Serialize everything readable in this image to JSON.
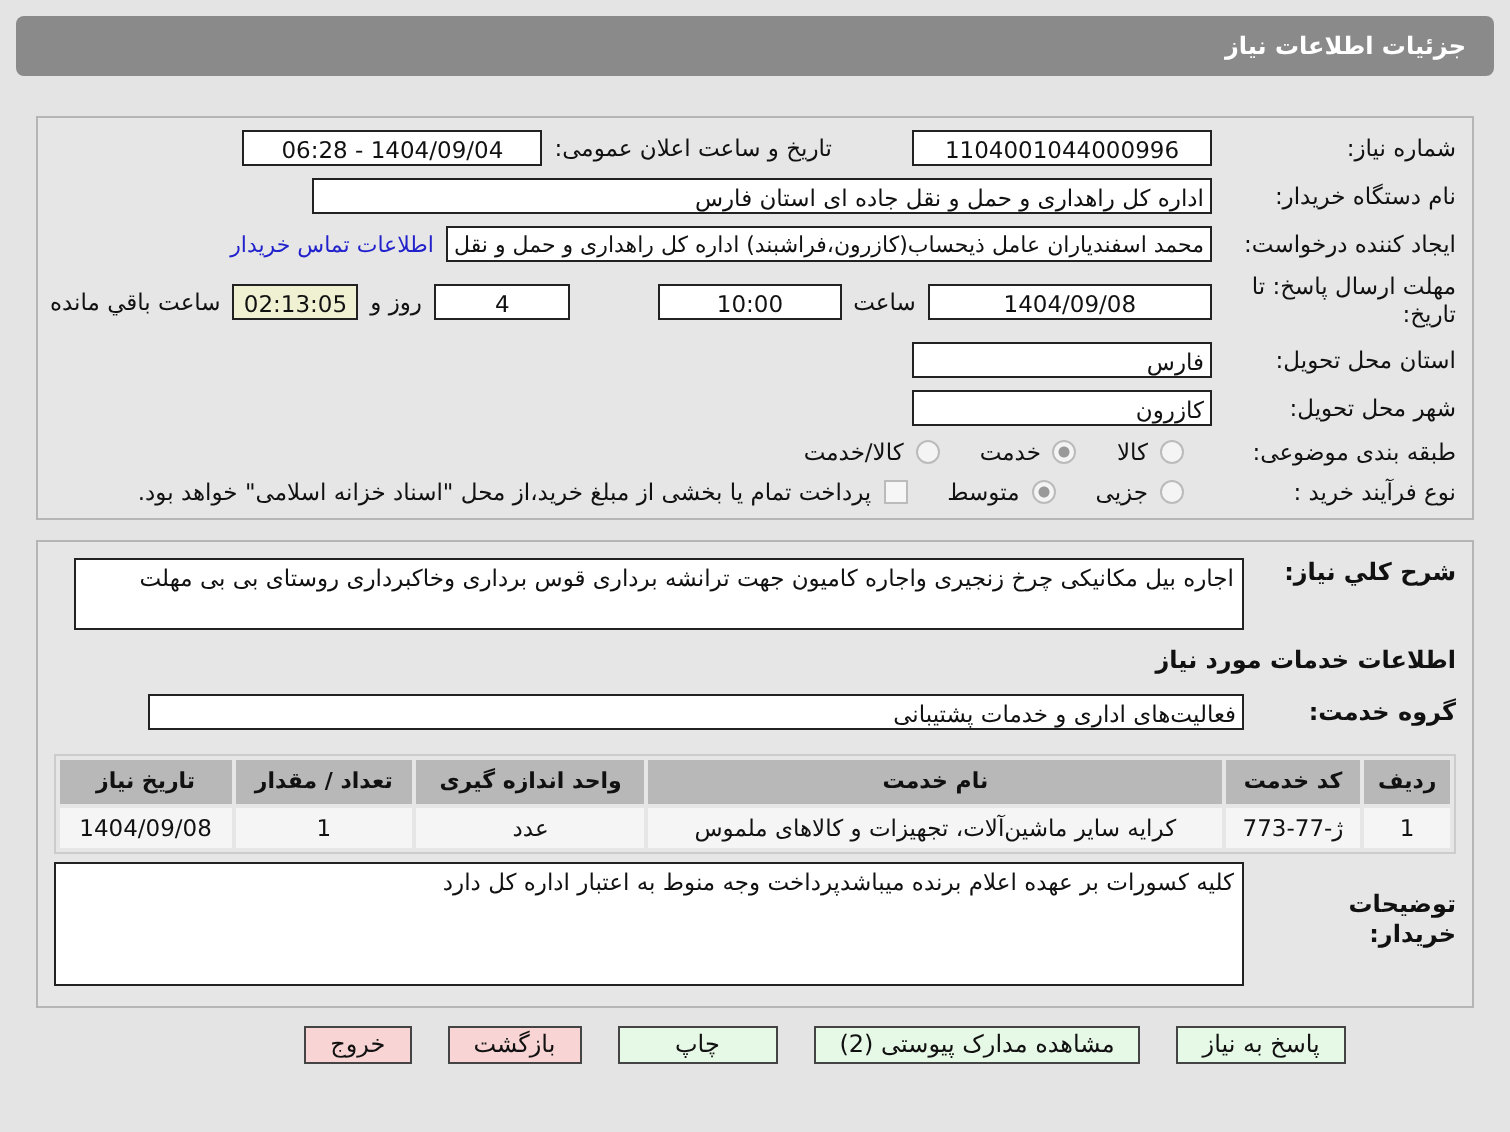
{
  "header": {
    "title": "جزئیات اطلاعات نیاز"
  },
  "need_number": {
    "label": "شماره نیاز:",
    "value": "1104001044000996"
  },
  "announce": {
    "label": "تاریخ و ساعت اعلان عمومی:",
    "value": "1404/09/04 - 06:28"
  },
  "buyer_org": {
    "label": "نام دستگاه خریدار:",
    "value": "اداره کل راهداری و حمل و نقل جاده ای استان فارس"
  },
  "requester": {
    "label": "ایجاد کننده درخواست:",
    "value": "محمد اسفندیاران عامل ذیحساب(کازرون،فراشبند) اداره کل راهداری و حمل و نقل",
    "link": "اطلاعات تماس خریدار"
  },
  "deadline": {
    "label": "مهلت ارسال پاسخ: تا تاریخ:",
    "date": "1404/09/08",
    "time_label": "ساعت",
    "time": "10:00",
    "days": "4",
    "days_label": "روز و",
    "remaining": "02:13:05",
    "remaining_label": "ساعت باقي مانده"
  },
  "province": {
    "label": "استان محل تحویل:",
    "value": "فارس"
  },
  "city": {
    "label": "شهر محل تحویل:",
    "value": "کازرون"
  },
  "category": {
    "label": "طبقه بندی موضوعی:",
    "options": [
      {
        "label": "کالا",
        "selected": false
      },
      {
        "label": "خدمت",
        "selected": true
      },
      {
        "label": "کالا/خدمت",
        "selected": false
      }
    ]
  },
  "process": {
    "label": "نوع فرآیند خرید :",
    "options": [
      {
        "label": "جزیی",
        "selected": false
      },
      {
        "label": "متوسط",
        "selected": true
      }
    ],
    "treasury": {
      "checked": false,
      "label": "پرداخت تمام یا بخشی از مبلغ خرید،از محل \"اسناد خزانه اسلامی\" خواهد بود."
    }
  },
  "description": {
    "label": "شرح کلي نياز:",
    "value": "اجاره بیل مکانیکی چرخ زنجیری واجاره کامیون  جهت ترانشه برداری قوس برداری وخاکبرداری روستای بی بی مهلت"
  },
  "services_heading": "اطلاعات خدمات مورد نیاز",
  "service_group": {
    "label": "گروه خدمت:",
    "value": "فعالیت‌های اداری و خدمات پشتیبانی"
  },
  "table": {
    "columns": [
      "ردیف",
      "کد خدمت",
      "نام خدمت",
      "واحد اندازه گیری",
      "تعداد / مقدار",
      "تاریخ نیاز"
    ],
    "rows": [
      [
        "1",
        "ژ-77-773",
        "کرایه سایر ماشین‌آلات، تجهیزات و کالاهای ملموس",
        "عدد",
        "1",
        "1404/09/08"
      ]
    ]
  },
  "buyer_notes": {
    "label": "توضیحات خریدار:",
    "value": "کلیه کسورات بر عهده اعلام برنده میباشدپرداخت وجه منوط به اعتبار اداره کل دارد"
  },
  "buttons": [
    {
      "label": "پاسخ به نیاز",
      "kind": "primary"
    },
    {
      "label": "مشاهده مدارک پیوستی (2)",
      "kind": "primary"
    },
    {
      "label": "چاپ",
      "kind": "primary"
    },
    {
      "label": "بازگشت",
      "kind": "danger"
    },
    {
      "label": "خروج",
      "kind": "danger"
    }
  ]
}
